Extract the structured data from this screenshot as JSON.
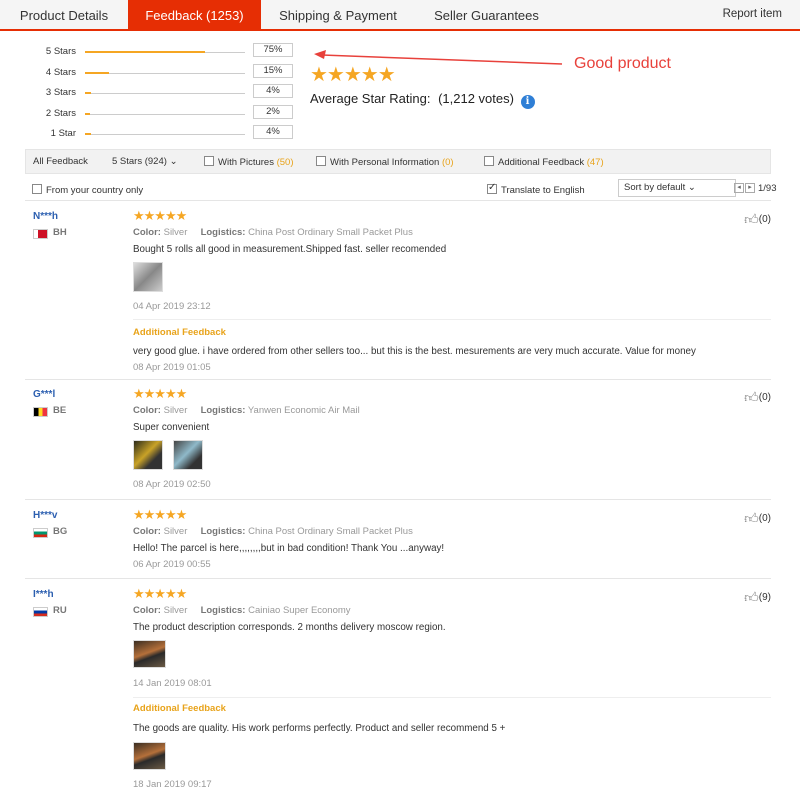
{
  "tabs": [
    "Product Details",
    "Feedback (1253)",
    "Shipping & Payment",
    "Seller Guarantees"
  ],
  "report_label": "Report item",
  "histogram": [
    {
      "label": "5 Stars",
      "pct": "75%",
      "fill": 0.75
    },
    {
      "label": "4 Stars",
      "pct": "15%",
      "fill": 0.15
    },
    {
      "label": "3 Stars",
      "pct": "4%",
      "fill": 0.04
    },
    {
      "label": "2 Stars",
      "pct": "2%",
      "fill": 0.02
    },
    {
      "label": "1 Star",
      "pct": "4%",
      "fill": 0.04
    }
  ],
  "rating": {
    "stars": "★★★★★",
    "label": "Average Star Rating:",
    "votes": "(1,212 votes)"
  },
  "annotation": "Good product",
  "filters": {
    "all": "All Feedback",
    "stars": "5 Stars (924)",
    "pictures_label": "With Pictures",
    "pictures_count": "(50)",
    "personal_label": "With Personal Information",
    "personal_count": "(0)",
    "additional_label": "Additional Feedback",
    "additional_count": "(47)"
  },
  "subbar": {
    "country": "From your country only",
    "translate": "Translate to English",
    "sort": "Sort by default",
    "page": "1/93"
  },
  "reviews": [
    {
      "user": "N***h",
      "country": "BH",
      "stars": "★★★★★",
      "color_label": "Color:",
      "color": "Silver",
      "logistics_label": "Logistics:",
      "logistics": "China Post Ordinary Small Packet Plus",
      "text": "Bought 5 rolls all good in measurement.Shipped fast. seller recomended",
      "date": "04 Apr 2019 23:12",
      "likes": "(0)",
      "additional_label": "Additional Feedback",
      "additional_text": "very good glue. i have ordered from other sellers too... but this is the best. mesurements are very much accurate. Value for money",
      "additional_date": "08 Apr 2019 01:05"
    },
    {
      "user": "G***l",
      "country": "BE",
      "stars": "★★★★★",
      "color_label": "Color:",
      "color": "Silver",
      "logistics_label": "Logistics:",
      "logistics": "Yanwen Economic Air Mail",
      "text": "Super convenient",
      "date": "08 Apr 2019 02:50",
      "likes": "(0)"
    },
    {
      "user": "H***v",
      "country": "BG",
      "stars": "★★★★★",
      "color_label": "Color:",
      "color": "Silver",
      "logistics_label": "Logistics:",
      "logistics": "China Post Ordinary Small Packet Plus",
      "text": "Hello! The parcel is here,,,,,,,,but in bad condition! Thank You ...anyway!",
      "date": "06 Apr 2019 00:55",
      "likes": "(0)"
    },
    {
      "user": "I***h",
      "country": "RU",
      "stars": "★★★★★",
      "color_label": "Color:",
      "color": "Silver",
      "logistics_label": "Logistics:",
      "logistics": "Cainiao Super Economy",
      "text": "The product description corresponds. 2 months delivery moscow region.",
      "date": "14 Jan 2019 08:01",
      "likes": "(9)",
      "additional_label": "Additional Feedback",
      "additional_text": "The goods are quality. His work performs perfectly. Product and seller recommend 5 +",
      "additional_date": "18 Jan 2019 09:17"
    }
  ],
  "colors": {
    "accent": "#e62e04",
    "star": "#f5a623",
    "link": "#2c5fb0",
    "annotation": "#e8413b"
  }
}
